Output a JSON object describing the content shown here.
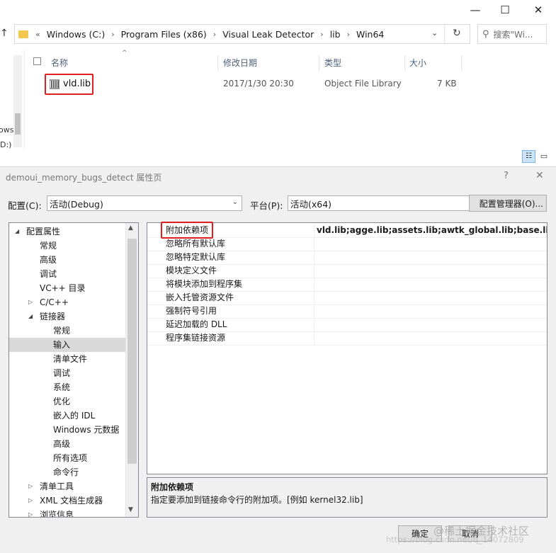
{
  "explorer": {
    "window_controls": [
      "—",
      "☐",
      "✕"
    ],
    "breadcrumb": [
      "Windows (C:)",
      "Program Files (x86)",
      "Visual Leak Detector",
      "lib",
      "Win64"
    ],
    "overflow_glyph": "«",
    "search_placeholder": "搜索\"Wi...",
    "columns": [
      "名称",
      "修改日期",
      "类型",
      "大小"
    ],
    "file": {
      "name": "vld.lib",
      "modified": "2017/1/30 20:30",
      "type": "Object File Library",
      "size": "7 KB"
    },
    "left_pane_fragments": [
      "ows",
      "D:)"
    ]
  },
  "dialog": {
    "title": "demoui_memory_bugs_detect 属性页",
    "help": "?",
    "close": "✕",
    "config_label": "配置(C):",
    "config_value": "活动(Debug)",
    "platform_label": "平台(P):",
    "platform_value": "活动(x64)",
    "config_manager_label": "配置管理器(O)...",
    "tree": [
      {
        "label": "配置属性",
        "level": 0,
        "expander": "down"
      },
      {
        "label": "常规",
        "level": 1
      },
      {
        "label": "高级",
        "level": 1
      },
      {
        "label": "调试",
        "level": 1
      },
      {
        "label": "VC++ 目录",
        "level": 1
      },
      {
        "label": "C/C++",
        "level": 1,
        "expander": "right"
      },
      {
        "label": "链接器",
        "level": 1,
        "expander": "down"
      },
      {
        "label": "常规",
        "level": 2
      },
      {
        "label": "输入",
        "level": 2,
        "selected": true
      },
      {
        "label": "清单文件",
        "level": 2
      },
      {
        "label": "调试",
        "level": 2
      },
      {
        "label": "系统",
        "level": 2
      },
      {
        "label": "优化",
        "level": 2
      },
      {
        "label": "嵌入的 IDL",
        "level": 2
      },
      {
        "label": "Windows 元数据",
        "level": 2
      },
      {
        "label": "高级",
        "level": 2
      },
      {
        "label": "所有选项",
        "level": 2
      },
      {
        "label": "命令行",
        "level": 2
      },
      {
        "label": "清单工具",
        "level": 1,
        "expander": "right"
      },
      {
        "label": "XML 文档生成器",
        "level": 1,
        "expander": "right"
      },
      {
        "label": "浏览信息",
        "level": 1,
        "expander": "right"
      }
    ],
    "properties": [
      {
        "name": "附加依赖项",
        "value": "vld.lib;agge.lib;assets.lib;awtk_global.lib;base.lib;cjson"
      },
      {
        "name": "忽略所有默认库",
        "value": ""
      },
      {
        "name": "忽略特定默认库",
        "value": ""
      },
      {
        "name": "模块定义文件",
        "value": ""
      },
      {
        "name": "将模块添加到程序集",
        "value": ""
      },
      {
        "name": "嵌入托管资源文件",
        "value": ""
      },
      {
        "name": "强制符号引用",
        "value": ""
      },
      {
        "name": "延迟加载的 DLL",
        "value": ""
      },
      {
        "name": "程序集链接资源",
        "value": ""
      }
    ],
    "description": {
      "title": "附加依赖项",
      "text": "指定要添加到链接命令行的附加项。[例如 kernel32.lib]"
    },
    "ok_label": "确定",
    "cancel_label": "取消"
  },
  "watermark": {
    "line1": "@稀土掘金技术社区",
    "line2": "https://blog.csdn.net/q_14072809"
  },
  "colors": {
    "highlight_box": "#e02020",
    "selected_tree": "#d9d9d9",
    "dialog_bg": "#f0f0f0"
  }
}
